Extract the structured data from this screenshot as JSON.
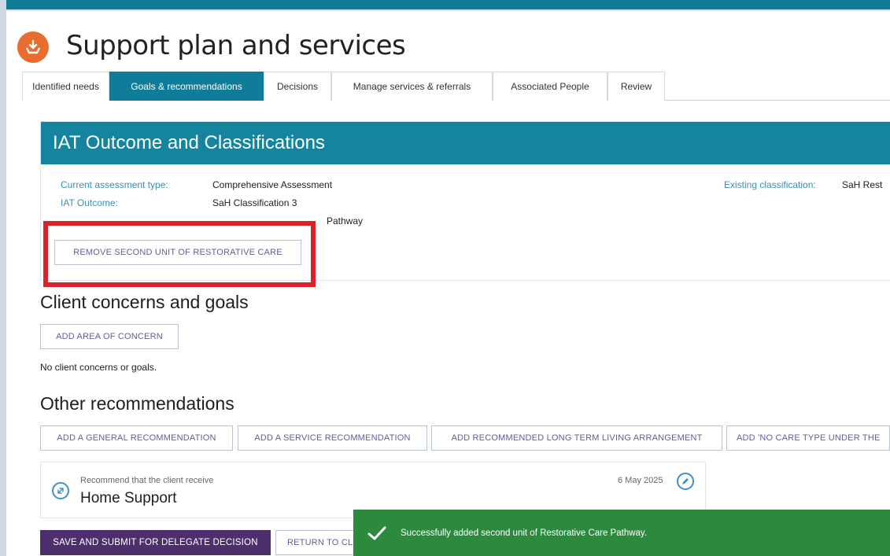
{
  "page": {
    "title": "Support plan and services",
    "icon": "support-plan-icon"
  },
  "tabs": [
    {
      "label": "Identified needs",
      "active": false
    },
    {
      "label": "Goals & recommendations",
      "active": true
    },
    {
      "label": "Decisions",
      "active": false
    },
    {
      "label": "Manage services & referrals",
      "active": false
    },
    {
      "label": "Associated People",
      "active": false
    },
    {
      "label": "Review",
      "active": false
    }
  ],
  "iat": {
    "header": "IAT Outcome and Classifications",
    "assessment_type_label": "Current assessment type:",
    "assessment_type_value": "Comprehensive Assessment",
    "outcome_label": "IAT Outcome:",
    "outcome_value": "SaH Classification 3",
    "third_value": "Pathway",
    "existing_label": "Existing classification:",
    "existing_value": "SaH Rest",
    "remove_button": "REMOVE SECOND UNIT OF RESTORATIVE CARE"
  },
  "concerns": {
    "title": "Client concerns and goals",
    "add_button": "ADD AREA OF CONCERN",
    "empty_text": "No client concerns or goals."
  },
  "other": {
    "title": "Other recommendations",
    "buttons": [
      "ADD A GENERAL RECOMMENDATION",
      "ADD A SERVICE RECOMMENDATION",
      "ADD RECOMMENDED LONG TERM LIVING ARRANGEMENT",
      "ADD 'NO CARE TYPE UNDER THE"
    ]
  },
  "recommendation": {
    "label": "Recommend that the client receive",
    "value": "Home Support",
    "date": "6 May 2025"
  },
  "footer": {
    "submit_button": "SAVE AND SUBMIT FOR DELEGATE DECISION",
    "return_button": "RETURN TO CLI"
  },
  "toast": {
    "message": "Successfully added second unit of Restorative Care Pathway."
  },
  "colors": {
    "brand_teal": "#15859f",
    "primary_purple": "#4d2f6e",
    "success_green": "#2c8a3e",
    "highlight_red": "#d9232b",
    "accent_orange": "#e96d2e"
  }
}
